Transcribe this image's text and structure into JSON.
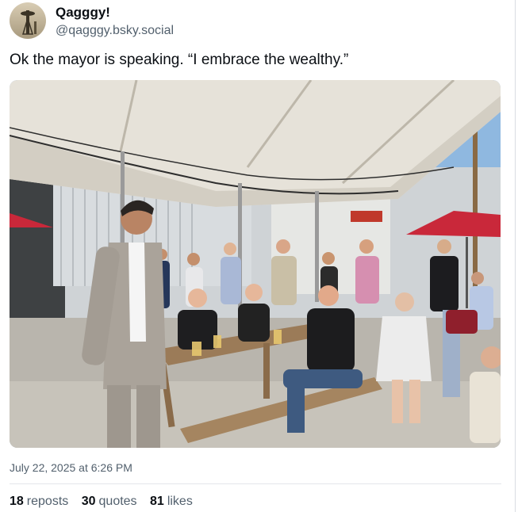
{
  "author": {
    "display_name": "Qagggy!",
    "handle": "@qagggy.bsky.social",
    "avatar_icon": "space-needle-avatar"
  },
  "post": {
    "text": "Ok the mayor is speaking. “I embrace the wealthy.”",
    "image_icon": "photo-mayor-speaking-under-tent",
    "timestamp": "July 22, 2025 at 6:26 PM"
  },
  "stats": {
    "reposts_count": "18",
    "reposts_label": "reposts",
    "quotes_count": "30",
    "quotes_label": "quotes",
    "likes_count": "81",
    "likes_label": "likes"
  }
}
